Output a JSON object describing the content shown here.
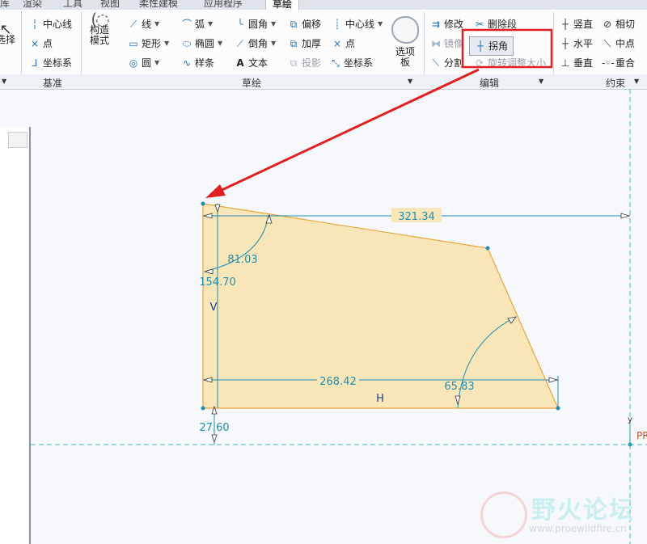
{
  "tabs": [
    "库",
    "渲染",
    "工具",
    "视图",
    "柔性建模",
    "应用程序",
    "草绘"
  ],
  "active_tab": "草绘",
  "ribbon": {
    "select_label": "选择",
    "datum": {
      "centerline": "中心线",
      "point": "点",
      "csys": "坐标系"
    },
    "construction_mode": "构造\n模式",
    "sketch": {
      "line": "线",
      "arc": "弧",
      "fillet": "圆角",
      "offset": "偏移",
      "centerline": "中心线",
      "rectangle": "矩形",
      "ellipse": "椭圆",
      "chamfer": "倒角",
      "thicken": "加厚",
      "point": "点",
      "circle": "圆",
      "spline": "样条",
      "text": "文本",
      "project": "投影",
      "csys": "坐标系"
    },
    "palette": "选项\n板",
    "edit": {
      "modify": "修改",
      "delete_segment": "删除段",
      "mirror": "镜像",
      "corner": "拐角",
      "divide": "分割",
      "rotate_resize": "旋转调整大小"
    },
    "constrain": {
      "vertical": "竖直",
      "tangent": "相切",
      "horizontal": "水平",
      "midpoint": "中点",
      "perpendicular": "垂直",
      "coincident": "重合"
    },
    "groups": {
      "datum": "基准",
      "sketch": "草绘",
      "edit": "编辑",
      "constrain": "约束"
    }
  },
  "dimensions": {
    "top_length": "321.34",
    "angle_top": "81.03",
    "height": "154.70",
    "bottom_length": "268.42",
    "angle_right": "65.83",
    "offset_vertical": "27.60",
    "constraint_v": "V",
    "constraint_h": "H",
    "csys_y": "y",
    "csys_label": "PR"
  },
  "watermark": {
    "title": "野火论坛",
    "url": "www.proewildfire.cn"
  },
  "colors": {
    "fill": "#f9e6b8",
    "edge": "#e8a33a",
    "dimension": "#1b8fb3",
    "highlight": "#e02020",
    "axis": "#3bbdc8"
  }
}
